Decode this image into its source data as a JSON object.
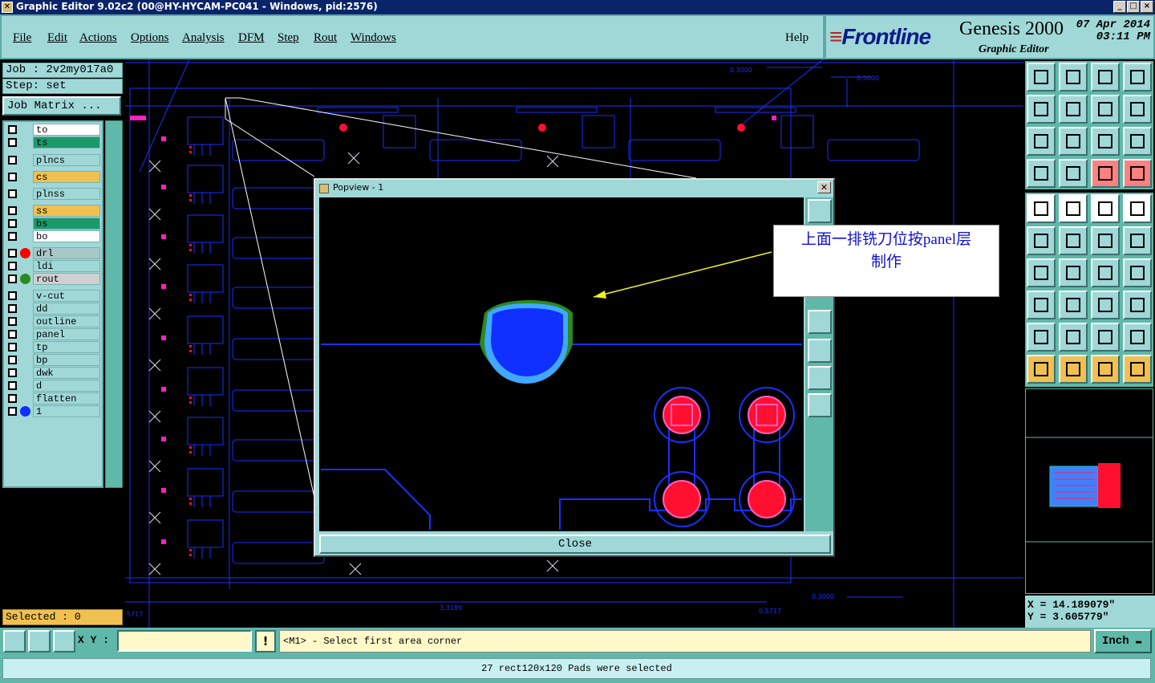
{
  "window": {
    "title": "Graphic Editor 9.02c2 (00@HY-HYCAM-PC041 - Windows, pid:2576)",
    "app_icon": "x-icon"
  },
  "menu": [
    "File",
    "Edit",
    "Actions",
    "Options",
    "Analysis",
    "DFM",
    "Step",
    "Rout",
    "Windows"
  ],
  "help": "Help",
  "brand": {
    "logo_prefix": "≡",
    "logo": "Frontline",
    "product": "Genesis 2000",
    "subtitle": "Graphic Editor",
    "date": "07 Apr 2014",
    "time": "03:11 PM"
  },
  "job": {
    "job_label": "Job : 2v2my017a0",
    "step_label": "Step: set",
    "matrix_button": "Job Matrix ..."
  },
  "layers": [
    {
      "name": "to",
      "bg": "#ffffff",
      "dot": ""
    },
    {
      "name": "ts",
      "bg": "#1a9a6a",
      "dot": ""
    },
    {
      "name": "plncs",
      "bg": "#a0d8d8",
      "dot": ""
    },
    {
      "name": "cs",
      "bg": "#f0c050",
      "dot": ""
    },
    {
      "name": "plnss",
      "bg": "#a0d8d8",
      "dot": ""
    },
    {
      "name": "ss",
      "bg": "#f0c050",
      "dot": ""
    },
    {
      "name": "bs",
      "bg": "#1a9a6a",
      "dot": ""
    },
    {
      "name": "bo",
      "bg": "#ffffff",
      "dot": ""
    },
    {
      "name": "drl",
      "bg": "#a8c8c8",
      "dot": "#ff0000"
    },
    {
      "name": "ldi",
      "bg": "#a0d8d8",
      "dot": ""
    },
    {
      "name": "rout",
      "bg": "#d0d0d0",
      "dot": "#2a8a20"
    },
    {
      "name": "v-cut",
      "bg": "#a0d8d8",
      "dot": ""
    },
    {
      "name": "dd",
      "bg": "#a0d8d8",
      "dot": ""
    },
    {
      "name": "outline",
      "bg": "#a0d8d8",
      "dot": ""
    },
    {
      "name": "panel",
      "bg": "#a0d8d8",
      "dot": ""
    },
    {
      "name": "tp",
      "bg": "#a0d8d8",
      "dot": ""
    },
    {
      "name": "bp",
      "bg": "#a0d8d8",
      "dot": ""
    },
    {
      "name": "dwk",
      "bg": "#a0d8d8",
      "dot": ""
    },
    {
      "name": "d",
      "bg": "#a0d8d8",
      "dot": ""
    },
    {
      "name": "flatten",
      "bg": "#a0d8d8",
      "dot": ""
    },
    {
      "name": "1",
      "bg": "#a0d8d8",
      "dot": "#1030ff"
    }
  ],
  "selected_count": "Selected : 0",
  "canvas": {
    "dims": [
      "0.3000",
      "0.5000",
      "3.3189",
      "0.3000",
      "0.5717",
      "5717"
    ]
  },
  "popview": {
    "title": "Popview - 1",
    "close_label": "Close"
  },
  "annotation": {
    "line1": "上面一排铣刀位按panel层",
    "line2": "制作"
  },
  "coords": {
    "x": "X = 14.189079\"",
    "y": "Y = 3.605779\""
  },
  "command": {
    "xy_label": "X Y :",
    "xy_value": "",
    "prompt": "<M1> - Select first area corner",
    "units": "Inch"
  },
  "status": "27 rect120x120 Pads were selected",
  "colors": {
    "panel_teal": "#a0d8d8",
    "dark_teal": "#5fb8a8",
    "trace_blue": "#1a30ff",
    "pad_red": "#ff1030",
    "magenta": "#ff20c0"
  }
}
